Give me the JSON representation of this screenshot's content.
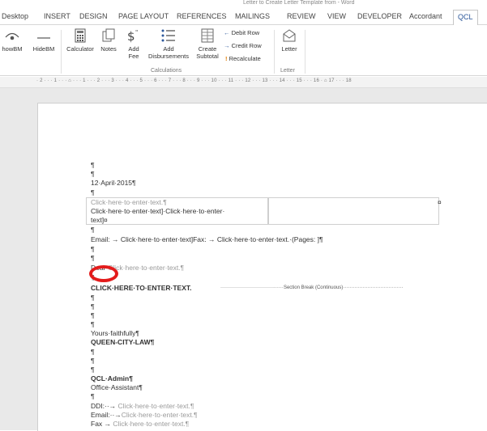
{
  "window_title": "Letter to Create Letter Template from - Word",
  "tabs": [
    "Desktop",
    "INSERT",
    "DESIGN",
    "PAGE LAYOUT",
    "REFERENCES",
    "MAILINGS",
    "REVIEW",
    "VIEW",
    "DEVELOPER",
    "Accordant",
    "QCL"
  ],
  "active_tab": "QCL",
  "ribbon": {
    "show_bm": "howBM",
    "hide_bm": "HideBM",
    "calculator": "Calculator",
    "notes": "Notes",
    "add_fee_1": "Add",
    "add_fee_2": "Fee",
    "add_disb_1": "Add",
    "add_disb_2": "Disbursements",
    "create_subtotal_1": "Create",
    "create_subtotal_2": "Subtotal",
    "debit_row": "Debit Row",
    "credit_row": "Credit Row",
    "recalculate": "Recalculate",
    "letter": "Letter",
    "group_calculations": "Calculations",
    "group_letter": "Letter"
  },
  "ruler_text": "· 2 · · · 1 · · · ⌂ · · · 1 · · · 2 · · · 3 · · · 4 · · · 5 · · · 6 · · · 7 · · · 8 · · · 9 · · · 10 · · · 11 · · · 12 · · · 13 · · · 14 · · · 15 · · · 16 · ⌂ 17 · · · 18",
  "doc": {
    "l1": "¶",
    "l2": "¶",
    "date": "12·April·2015¶",
    "l4": "¶",
    "cell1_line1": "Click·here·to·enter·text.¶",
    "cell1_line2": "Click·here·to·enter·text]·Click·here·to·enter·",
    "cell1_line3": "text]¤",
    "cell_end": "¤",
    "l6": "¶",
    "email_line": "Email:  →  Click·here·to·enter·text]Fax: → Click·here·to·enter·text.·(Pages: ]¶",
    "l8": "¶",
    "l9": "¶",
    "dear_prefix": "Dear·",
    "dear_text": "Click·here·to·enter·text.¶",
    "l11": "¶",
    "caps_line": "CLICK·HERE·TO·ENTER·TEXT.",
    "section_break": "Section Break (Continuous)",
    "l13": "¶",
    "l14": "¶",
    "l15": "¶",
    "l16": "¶",
    "yours": "Yours·faithfully¶",
    "firm": "QUEEN-CITY-LAW¶",
    "l19": "¶",
    "l20": "¶",
    "l21": "¶",
    "admin": "QCL·Admin¶",
    "role": "Office·Assistant¶",
    "l24": "¶",
    "ddi_label": "DDI:··→",
    "ddi_value": "Click·here·to·enter·text.¶",
    "email_label": "Email:··→",
    "email_value": "Click·here·to·enter·text.¶",
    "fax_label": "Fax  →",
    "fax_value": "Click·here·to·enter·text.¶"
  }
}
